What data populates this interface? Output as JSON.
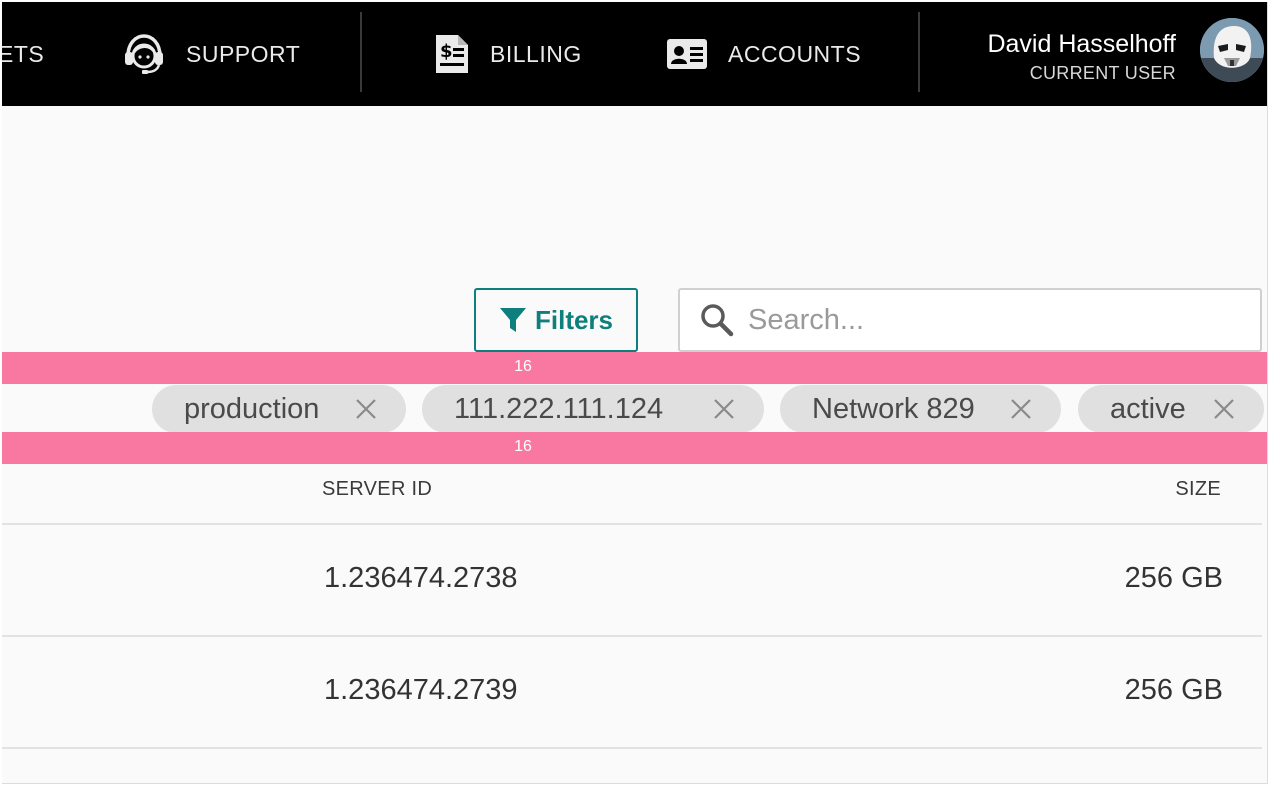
{
  "nav": {
    "partial_label": "ETS",
    "support_label": "SUPPORT",
    "billing_label": "BILLING",
    "accounts_label": "ACCOUNTS"
  },
  "user": {
    "name": "David Hasselhoff",
    "role": "CURRENT USER"
  },
  "toolbar": {
    "filters_label": "Filters",
    "search_placeholder": "Search..."
  },
  "spacing_annotations": {
    "top": "16",
    "bottom": "16"
  },
  "chips": [
    {
      "label": "production"
    },
    {
      "label": "111.222.111.124"
    },
    {
      "label": "Network 829"
    },
    {
      "label": "active"
    }
  ],
  "table": {
    "columns": {
      "server_id": "SERVER ID",
      "size": "SIZE"
    },
    "rows": [
      {
        "server_id": "1.236474.2738",
        "size": "256 GB"
      },
      {
        "server_id": "1.236474.2739",
        "size": "256 GB"
      }
    ]
  },
  "colors": {
    "accent": "#0e7f7c",
    "topbar": "#000000",
    "chip_bg": "#e0e0e0",
    "spacing_marker": "#f978a2"
  }
}
